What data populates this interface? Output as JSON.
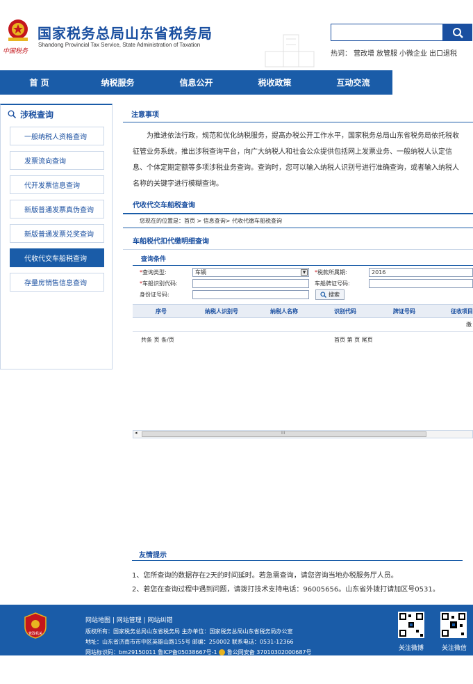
{
  "header": {
    "title": "国家税务总局山东省税务局",
    "subtitle": "Shandong Provincial Tax Service, State Administration of Taxation",
    "slogan": "中国税务",
    "search": {
      "placeholder": ""
    },
    "hotwords_label": "热词：",
    "hotwords": [
      "营改增",
      "放管服",
      "小微企业",
      "出口退税"
    ]
  },
  "nav": [
    "首 页",
    "纳税服务",
    "信息公开",
    "税收政策",
    "互动交流"
  ],
  "sidebar": {
    "title": "涉税查询",
    "items": [
      {
        "label": "一般纳税人资格查询",
        "active": false
      },
      {
        "label": "发票流向查询",
        "active": false
      },
      {
        "label": "代开发票信息查询",
        "active": false
      },
      {
        "label": "新版普通发票真伪查询",
        "active": false
      },
      {
        "label": "新版普通发票兑奖查询",
        "active": false
      },
      {
        "label": "代收代交车船税查询",
        "active": true
      },
      {
        "label": "存量房销售信息查询",
        "active": false
      }
    ]
  },
  "main": {
    "notice_title": "注意事项",
    "notice_text": "为推进依法行政，规范和优化纳税服务，提高办税公开工作水平，国家税务总局山东省税务局依托税收征管业务系统，推出涉税查询平台，向广大纳税人和社会公众提供包括网上发票业务、一般纳税人认定信息、个体定期定额等多项涉税业务查询。查询时，您可以输入纳税人识别号进行准确查询，或者输入纳税人名称的关键字进行模糊查询。",
    "section_title": "代收代交车船税查询",
    "breadcrumb": "您现在的位置是：首页 > 信息查询> 代收代缴车船税查询",
    "sub_title": "车船税代扣代缴明细查询",
    "conditions_title": "查询条件",
    "form": {
      "type_label": "查询类型:",
      "type_value": "车辆",
      "period_label": "税款所属期:",
      "period_value": "2016",
      "vehicle_id_label": "车船识别代码:",
      "plate_label": "车船牌证号码:",
      "idcard_label": "身份证号码:",
      "search_button": "搜索"
    },
    "table": {
      "columns": [
        "序号",
        "纳税人识别号",
        "纳税人名称",
        "识别代码",
        "牌证号码",
        "征收项目"
      ],
      "row_fragment": "缴",
      "pager_left": "共条 页 条/页",
      "pager_right": "首页 第 页 尾页"
    },
    "scroll_mark": "III"
  },
  "tips": {
    "title": "友情提示",
    "items": [
      "1、您所查询的数据存在2天的时间延时。若急需查询，请您咨询当地办税服务厅人员。",
      "2、若您在查询过程中遇到问题，请拨打技术支持电话：96005656。山东省外拨打请加区号0531。"
    ]
  },
  "footer": {
    "links": "网站地图 | 网站管理 | 网站纠错",
    "copyright": "版权所有：国家税务总局山东省税务局 主办单位：国家税务总局山东省税务局办公室",
    "address": "地址：山东省济南市市中区英雄山路155号 邮编：250002 联系电话：0531-12366",
    "record": "网站标识码：bm29150011 鲁ICP备05038667号-1",
    "police": "鲁公网安备 37010302000687号",
    "badge_text": "党政机关",
    "qr1_caption": "关注微博",
    "qr2_caption": "关注微信"
  },
  "colors": {
    "brand": "#1a5ca8",
    "title": "#1a4fa0",
    "red": "#c4161c"
  }
}
